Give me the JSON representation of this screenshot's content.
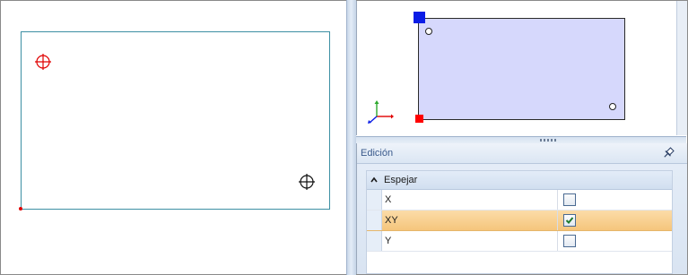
{
  "colors": {
    "sheet_border": "#3c8fa3",
    "origin_marker": "#e00000",
    "preview_fill": "#d6d8fc",
    "handle_blue": "#0a1ce6",
    "handle_red": "#ff0000",
    "selection": "#f5c57c",
    "panel_title": "#3a5a8c"
  },
  "icons": {
    "crosshair_red": "crosshair-target-icon",
    "crosshair_black": "crosshair-target-icon",
    "axis": "xyz-axis-gizmo-icon",
    "pin": "pin-icon",
    "collapse": "chevron-up-icon",
    "check": "checkmark-icon"
  },
  "panel": {
    "title": "Edición",
    "group": {
      "label": "Espejar",
      "expanded": true
    },
    "properties": [
      {
        "name": "X",
        "checked": false,
        "selected": false
      },
      {
        "name": "XY",
        "checked": true,
        "selected": true
      },
      {
        "name": "Y",
        "checked": false,
        "selected": false
      }
    ]
  }
}
